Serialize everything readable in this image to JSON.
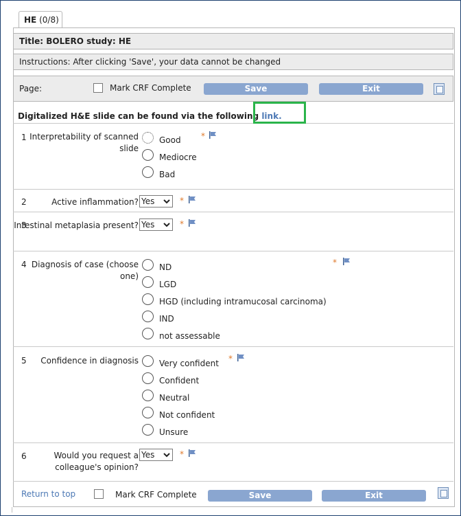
{
  "tab": {
    "name": "HE",
    "count": "(0/8)"
  },
  "title": "Title: BOLERO study: HE",
  "instructions": "Instructions: After clicking 'Save', your data cannot be changed",
  "toolbar": {
    "page_label": "Page:",
    "mark_complete": "Mark CRF Complete",
    "save": "Save",
    "exit": "Exit"
  },
  "digital": {
    "text": "Digitalized H&E slide can be found via the following",
    "link": "link."
  },
  "questions": [
    {
      "num": "1",
      "label": "Interpretability of scanned slide",
      "options": [
        "Good",
        "Mediocre",
        "Bad"
      ]
    },
    {
      "num": "2",
      "label": "Active inflammation?",
      "value": "Yes"
    },
    {
      "num": "3",
      "label": "Intestinal metaplasia present?",
      "value": "Yes"
    },
    {
      "num": "4",
      "label": "Diagnosis of case (choose one)",
      "options": [
        "ND",
        "LGD",
        "HGD (including intramucosal carcinoma)",
        "IND",
        "not assessable"
      ]
    },
    {
      "num": "5",
      "label": "Confidence in diagnosis",
      "options": [
        "Very confident",
        "Confident",
        "Neutral",
        "Not confident",
        "Unsure"
      ]
    },
    {
      "num": "6",
      "label": "Would you request a colleague's opinion?",
      "value": "Yes"
    }
  ],
  "required_mark": "*",
  "footer": {
    "return_top": "Return to top",
    "mark_complete": "Mark CRF Complete",
    "save": "Save",
    "exit": "Exit"
  },
  "colors": {
    "button": "#8aa6d0",
    "link": "#4d79b5",
    "required": "#e07a2c",
    "highlight": "#2ab44a"
  },
  "icons": {
    "flag": "flag-icon",
    "document": "document-icon",
    "dropdown": "chevron-down-icon"
  }
}
